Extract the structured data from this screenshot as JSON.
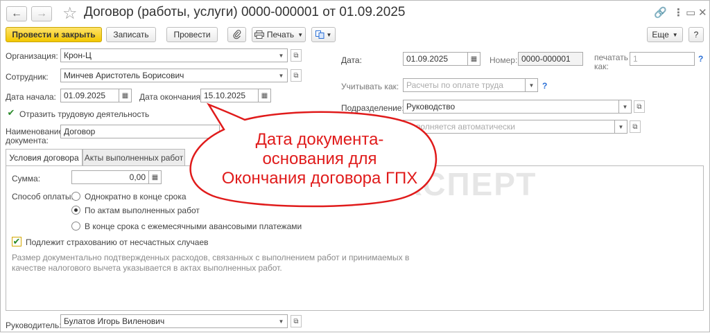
{
  "window": {
    "title": "Договор (работы, услуги) 0000-000001 от 01.09.2025",
    "back_icon": "←",
    "forward_icon": "→",
    "star_icon": "☆",
    "link_icon": "🔗",
    "more_icon": "⋮",
    "restore_icon": "▭",
    "close_icon": "✕"
  },
  "toolbar": {
    "post_close": "Провести и закрыть",
    "save": "Записать",
    "post": "Провести",
    "print": "Печать",
    "more": "Еще",
    "help": "?"
  },
  "form": {
    "org_label": "Организация:",
    "org_value": "Крон-Ц",
    "emp_label": "Сотрудник:",
    "emp_value": "Минчев Аристотель Борисович",
    "start_label": "Дата начала:",
    "start_value": "01.09.2025",
    "end_label": "Дата окончания:",
    "end_value": "15.10.2025",
    "reflect_label": "Отразить трудовую деятельность",
    "docname_label_1": "Наименование",
    "docname_label_2": "документа:",
    "docname_value": "Договор",
    "date_label": "Дата:",
    "date_value": "01.09.2025",
    "number_label": "Номер:",
    "number_value": "0000-000001",
    "print_as_label_1": "печатать",
    "print_as_label_2": "как:",
    "print_as_placeholder": "1",
    "account_label": "Учитывать как:",
    "account_placeholder": "Расчеты по оплате труда",
    "dept_label": "Подразделение:",
    "dept_value": "Руководство",
    "auto_placeholder": "Заполняется автоматически",
    "manager_label": "Руководитель:",
    "manager_value": "Булатов Игорь Виленович",
    "help_q": "?"
  },
  "tabs": [
    {
      "label": "Условия договора"
    },
    {
      "label": "Акты выполненных работ"
    }
  ],
  "terms": {
    "sum_label": "Сумма:",
    "sum_value": "0,00",
    "pay_label": "Способ оплаты:",
    "pay_options": [
      {
        "label": "Однократно в конце срока"
      },
      {
        "label": "По актам выполненных работ"
      },
      {
        "label": "В конце срока с ежемесячными авансовыми платежами"
      }
    ],
    "insurance_label": "Подлежит страхованию от несчастных случаев",
    "note": "Размер документально подтвержденных расходов, связанных с выполнением работ и принимаемых в качестве налогового вычета указывается в актах выполненных работ."
  },
  "callout": {
    "line1": "Дата документа-",
    "line2": "основания для",
    "line3": "Окончания договора ГПХ"
  },
  "watermark": "БУХЭКСПЕРТ",
  "colors": {
    "accent": "#f2c700",
    "callout": "#e01b1b"
  }
}
